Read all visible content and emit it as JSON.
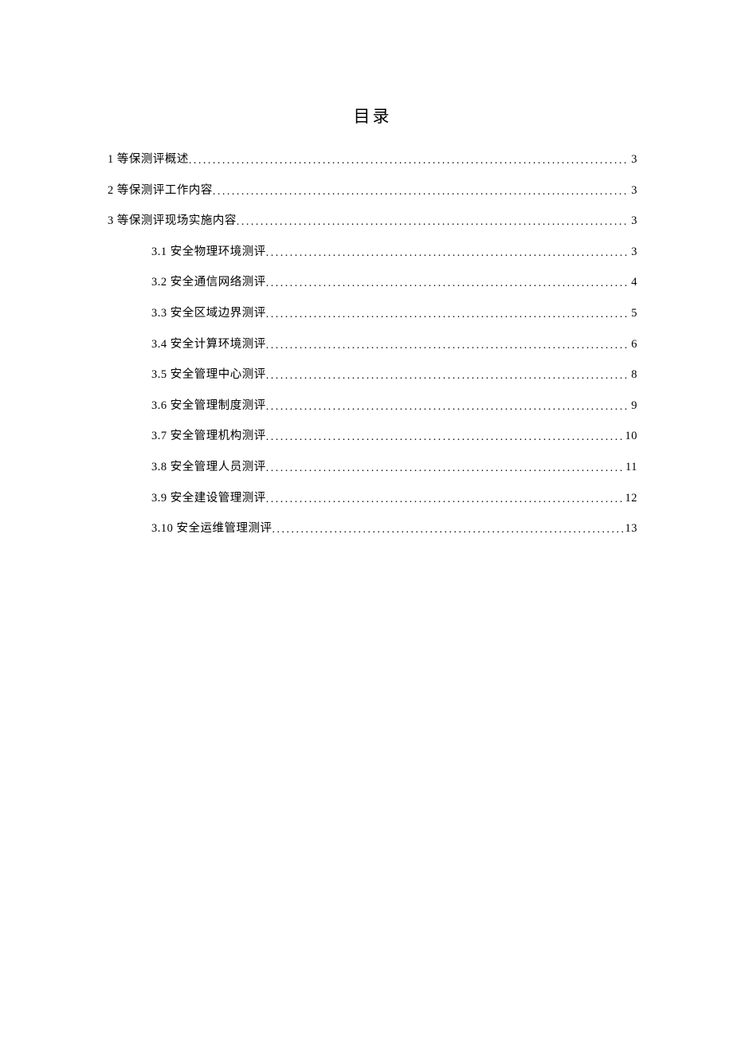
{
  "title": "目录",
  "toc": [
    {
      "level": 1,
      "label": "1 等保测评概述",
      "page": "3"
    },
    {
      "level": 1,
      "label": "2 等保测评工作内容",
      "page": "3"
    },
    {
      "level": 1,
      "label": "3 等保测评现场实施内容",
      "page": "3"
    },
    {
      "level": 2,
      "label": "3.1 安全物理环境测评",
      "page": "3"
    },
    {
      "level": 2,
      "label": "3.2 安全通信网络测评",
      "page": "4"
    },
    {
      "level": 2,
      "label": "3.3 安全区域边界测评",
      "page": "5"
    },
    {
      "level": 2,
      "label": "3.4 安全计算环境测评",
      "page": "6"
    },
    {
      "level": 2,
      "label": "3.5 安全管理中心测评",
      "page": "8"
    },
    {
      "level": 2,
      "label": "3.6 安全管理制度测评",
      "page": "9"
    },
    {
      "level": 2,
      "label": "3.7 安全管理机构测评",
      "page": "10"
    },
    {
      "level": 2,
      "label": "3.8 安全管理人员测评",
      "page": "11"
    },
    {
      "level": 2,
      "label": "3.9 安全建设管理测评",
      "page": "12"
    },
    {
      "level": 2,
      "label": "3.10 安全运维管理测评",
      "page": "13"
    }
  ]
}
